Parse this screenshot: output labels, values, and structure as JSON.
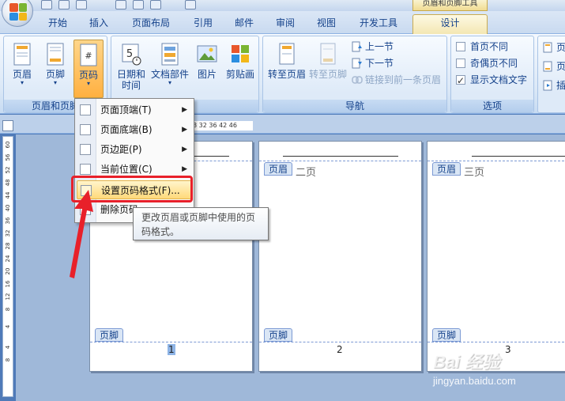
{
  "title_bar": {
    "context_title": "页眉和页脚工具"
  },
  "tabs": [
    {
      "label": "开始"
    },
    {
      "label": "插入"
    },
    {
      "label": "页面布局"
    },
    {
      "label": "引用"
    },
    {
      "label": "邮件"
    },
    {
      "label": "审阅"
    },
    {
      "label": "视图"
    },
    {
      "label": "开发工具"
    },
    {
      "label": "设计"
    }
  ],
  "ribbon": {
    "header_footer_group": {
      "label": "页眉和页脚",
      "header": "页眉",
      "footer": "页脚",
      "page_number": "页码"
    },
    "insert_group": {
      "date_time_1": "日期和",
      "date_time_2": "时间",
      "doc_parts": "文档部件",
      "picture": "图片",
      "clip_art": "剪贴画"
    },
    "navigation_group": {
      "label": "导航",
      "goto_header": "转至页眉",
      "goto_footer": "转至页脚",
      "prev_section": "上一节",
      "next_section": "下一节",
      "link_to_previous": "链接到前一条页眉"
    },
    "options_group": {
      "label": "选项",
      "different_first": "首页不同",
      "different_first_checked": false,
      "different_odd_even": "奇偶页不同",
      "different_odd_even_checked": false,
      "show_doc_text": "显示文档文字",
      "show_doc_text_checked": true
    },
    "position_group": {
      "item1": "页",
      "item2": "页",
      "item3": "插"
    }
  },
  "ruler": {
    "h_ticks": "8  32  36  42  46",
    "v_ticks": [
      "60",
      "56",
      "52",
      "48",
      "44",
      "40",
      "36",
      "32",
      "28",
      "24",
      "20",
      "16",
      "12",
      "8",
      "4",
      "4",
      "8"
    ]
  },
  "pages": [
    {
      "header_tag": "页眉",
      "header_text": "",
      "footer_tag": "页脚",
      "page_num": "1"
    },
    {
      "header_tag": "页眉",
      "header_text": "二页",
      "footer_tag": "页脚",
      "page_num": "2"
    },
    {
      "header_tag": "页眉",
      "header_text": "三页",
      "footer_tag": "页脚",
      "page_num": "3"
    }
  ],
  "page_number_menu": {
    "items": [
      {
        "label": "页面顶端(T)",
        "submenu": true
      },
      {
        "label": "页面底端(B)",
        "submenu": true
      },
      {
        "label": "页边距(P)",
        "submenu": true
      },
      {
        "label": "当前位置(C)",
        "submenu": true
      },
      {
        "label": "设置页码格式(F)...",
        "submenu": false,
        "hover": true
      },
      {
        "label": "删除页码",
        "submenu": false
      }
    ]
  },
  "tooltip": {
    "text_line1": "更改页眉或页脚中使用的页",
    "text_line2": "码格式。"
  },
  "watermark": {
    "brand": "Bai  经验",
    "url": "jingyan.baidu.com"
  },
  "colors": {
    "highlight": "#e8202a",
    "ribbon_accent": "#15428b",
    "pressed": "#ffb040"
  }
}
